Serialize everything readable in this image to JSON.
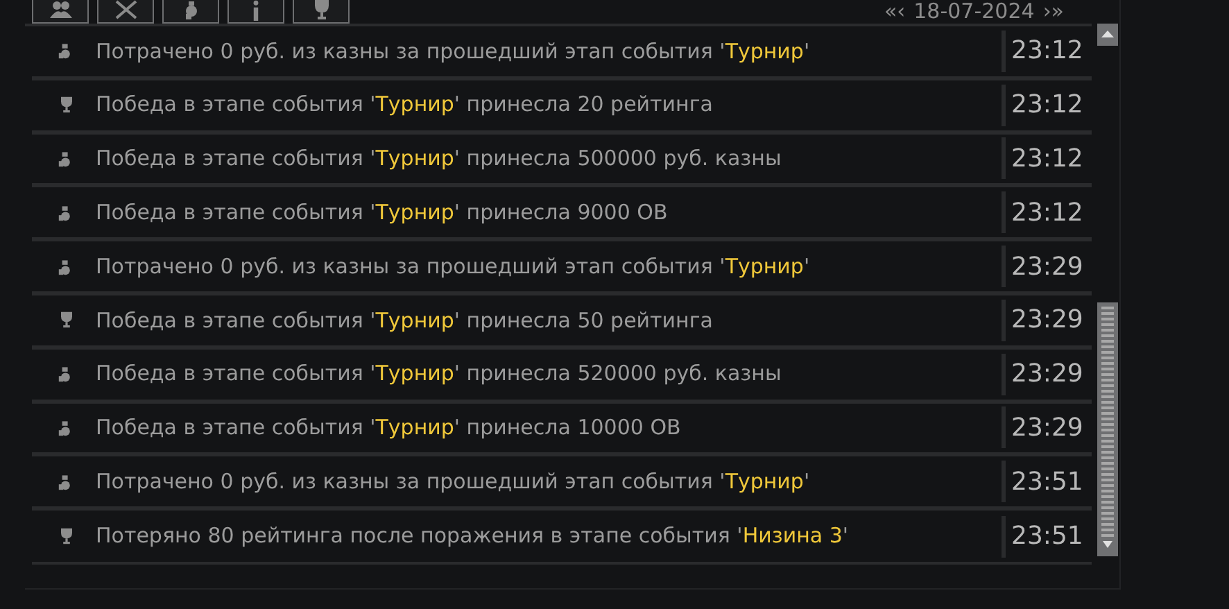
{
  "date_nav": {
    "prev": "«‹",
    "date": "18-07-2024",
    "next": "›»"
  },
  "log": [
    {
      "kind": "money",
      "prefix": "Потрачено 0 руб. из казны за прошедший этап события '",
      "event": "Турнир",
      "suffix": "'",
      "time": "23:12"
    },
    {
      "kind": "rating",
      "prefix": "Победа в этапе события '",
      "event": "Турнир",
      "suffix": "' принесла 20 рейтинга",
      "time": "23:12"
    },
    {
      "kind": "money",
      "prefix": "Победа в этапе события '",
      "event": "Турнир",
      "suffix": "' принесла 500000 руб. казны",
      "time": "23:12"
    },
    {
      "kind": "money",
      "prefix": "Победа в этапе события '",
      "event": "Турнир",
      "suffix": "' принесла 9000 ОВ",
      "time": "23:12"
    },
    {
      "kind": "money",
      "prefix": "Потрачено 0 руб. из казны за прошедший этап события '",
      "event": "Турнир",
      "suffix": "'",
      "time": "23:29"
    },
    {
      "kind": "rating",
      "prefix": "Победа в этапе события '",
      "event": "Турнир",
      "suffix": "' принесла 50 рейтинга",
      "time": "23:29"
    },
    {
      "kind": "money",
      "prefix": "Победа в этапе события '",
      "event": "Турнир",
      "suffix": "' принесла 520000 руб. казны",
      "time": "23:29"
    },
    {
      "kind": "money",
      "prefix": "Победа в этапе события '",
      "event": "Турнир",
      "suffix": "' принесла 10000 ОВ",
      "time": "23:29"
    },
    {
      "kind": "money",
      "prefix": "Потрачено 0 руб. из казны за прошедший этап события '",
      "event": "Турнир",
      "suffix": "'",
      "time": "23:51"
    },
    {
      "kind": "rating",
      "prefix": "Потеряно 80 рейтинга после поражения в этапе события '",
      "event": "Низина 3",
      "suffix": "'",
      "time": "23:51"
    }
  ]
}
